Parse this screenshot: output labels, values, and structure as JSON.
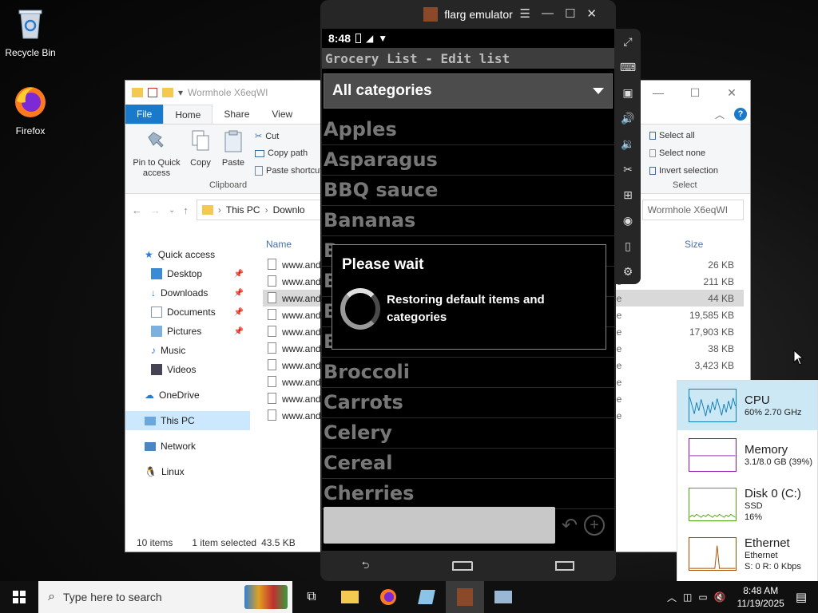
{
  "desktop": {
    "icons": [
      {
        "label": "Recycle Bin"
      },
      {
        "label": "Firefox"
      }
    ]
  },
  "explorer": {
    "title": "Wormhole X6eqWI",
    "tabs": [
      "File",
      "Home",
      "Share",
      "View"
    ],
    "ribbon": {
      "pin_label": "Pin to Quick access",
      "copy_label": "Copy",
      "paste_label": "Paste",
      "cut_label": "Cut",
      "copy_path_label": "Copy path",
      "paste_shortcut_label": "Paste shortcut",
      "clipboard_group": "Clipboard",
      "select_all_label": "Select all",
      "select_none_label": "Select none",
      "invert_selection_label": "Invert selection",
      "select_group": "Select"
    },
    "address": {
      "crumbs": [
        "This PC",
        "Downlo"
      ],
      "search_text": "Wormhole X6eqWI"
    },
    "nav": [
      {
        "label": "Quick access"
      },
      {
        "label": "Desktop",
        "pinned": true
      },
      {
        "label": "Downloads",
        "pinned": true
      },
      {
        "label": "Documents",
        "pinned": true
      },
      {
        "label": "Pictures",
        "pinned": true
      },
      {
        "label": "Music"
      },
      {
        "label": "Videos"
      },
      {
        "label": "OneDrive"
      },
      {
        "label": "This PC"
      },
      {
        "label": "Network"
      },
      {
        "label": "Linux"
      }
    ],
    "columns": {
      "name": "Name",
      "size": "Size"
    },
    "files": [
      {
        "name": "www.and",
        "type": "",
        "size": "26 KB"
      },
      {
        "name": "www.and",
        "type": "le",
        "size": "211 KB"
      },
      {
        "name": "www.and",
        "type": "le",
        "size": "44 KB"
      },
      {
        "name": "www.and",
        "type": "le",
        "size": "19,585 KB"
      },
      {
        "name": "www.and",
        "type": "le",
        "size": "17,903 KB"
      },
      {
        "name": "www.and",
        "type": "le",
        "size": "38 KB"
      },
      {
        "name": "www.and",
        "type": "le",
        "size": "3,423 KB"
      },
      {
        "name": "www.and",
        "type": "le",
        "size": ""
      },
      {
        "name": "www.and",
        "type": "le",
        "size": ""
      },
      {
        "name": "www.and",
        "type": "le",
        "size": ""
      }
    ],
    "status": {
      "count": "10 items",
      "selected": "1 item selected",
      "size": "43.5 KB"
    }
  },
  "emulator": {
    "title": "flarg emulator",
    "phone": {
      "time": "8:48",
      "app_title": "Grocery List - Edit list",
      "category_spinner": "All categories",
      "items": [
        "Apples",
        "Asparagus",
        "BBQ sauce",
        "Bananas",
        "B",
        "B",
        "B",
        "Bouillon cubes",
        "Broccoli",
        "Carrots",
        "Celery",
        "Cereal",
        "Cherries"
      ],
      "dialog": {
        "title": "Please wait",
        "message": "Restoring default items and categories"
      }
    }
  },
  "perf": [
    {
      "name": "CPU",
      "sub1": "60%  2.70 GHz",
      "sub2": "",
      "color": "#117dbb"
    },
    {
      "name": "Memory",
      "sub1": "3.1/8.0 GB (39%)",
      "sub2": "",
      "color": "#8b12ae"
    },
    {
      "name": "Disk 0 (C:)",
      "sub1": "SSD",
      "sub2": "16%",
      "color": "#4da60c"
    },
    {
      "name": "Ethernet",
      "sub1": "Ethernet",
      "sub2": "S: 0  R: 0 Kbps",
      "color": "#a74f01"
    }
  ],
  "taskbar": {
    "search_placeholder": "Type here to search",
    "time": "8:48 AM",
    "date": "11/19/2025"
  }
}
